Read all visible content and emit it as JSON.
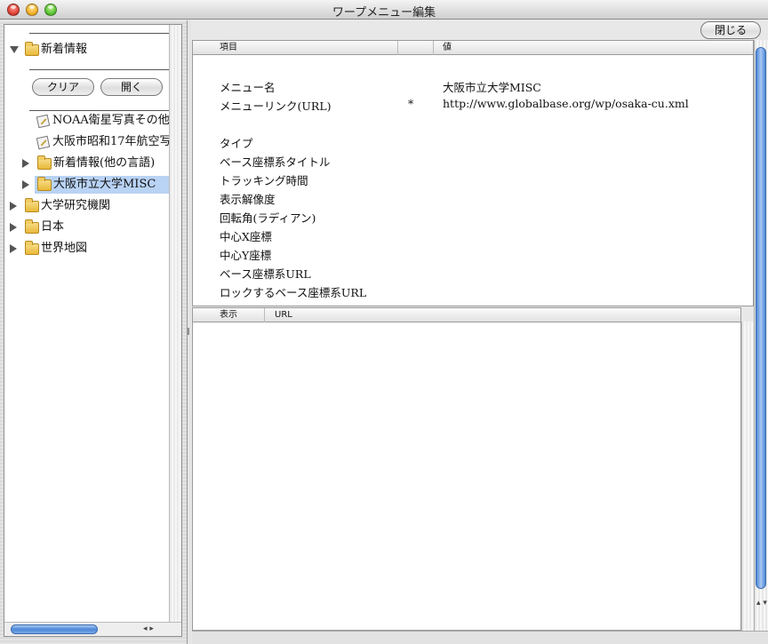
{
  "window": {
    "title": "ワープメニュー編集"
  },
  "tree": {
    "root_label": "新着情報",
    "buttons": {
      "clear": "クリア",
      "open": "開く"
    },
    "items": [
      {
        "label": "NOAA衛星写真その他"
      },
      {
        "label": "大阪市昭和17年航空写"
      },
      {
        "label": "新着情報(他の言語)"
      },
      {
        "label": "大阪市立大学MISC"
      },
      {
        "label": "大学研究機関"
      },
      {
        "label": "日本"
      },
      {
        "label": "世界地図"
      }
    ],
    "scroll_arrows": "◂ ▸"
  },
  "toolbar": {
    "close_label": "閉じる"
  },
  "properties": {
    "headers": {
      "item": "項目",
      "value": "値"
    },
    "rows": [
      {
        "name": "メニュー名",
        "flag": "",
        "value": "大阪市立大学MISC"
      },
      {
        "name": "メニューリンク(URL)",
        "flag": "*",
        "value": "http://www.globalbase.org/wp/osaka-cu.xml"
      },
      {
        "name": "タイプ",
        "flag": "",
        "value": ""
      },
      {
        "name": "ベース座標系タイトル",
        "flag": "",
        "value": ""
      },
      {
        "name": "トラッキング時間",
        "flag": "",
        "value": ""
      },
      {
        "name": "表示解像度",
        "flag": "",
        "value": ""
      },
      {
        "name": "回転角(ラディアン)",
        "flag": "",
        "value": ""
      },
      {
        "name": "中心X座標",
        "flag": "",
        "value": ""
      },
      {
        "name": "中心Y座標",
        "flag": "",
        "value": ""
      },
      {
        "name": "ベース座標系URL",
        "flag": "",
        "value": ""
      },
      {
        "name": "ロックするベース座標系URL",
        "flag": "",
        "value": ""
      }
    ]
  },
  "url_list": {
    "headers": {
      "display": "表示",
      "url": "URL"
    }
  },
  "scroll_arrows_vertical": "▴ ▾"
}
